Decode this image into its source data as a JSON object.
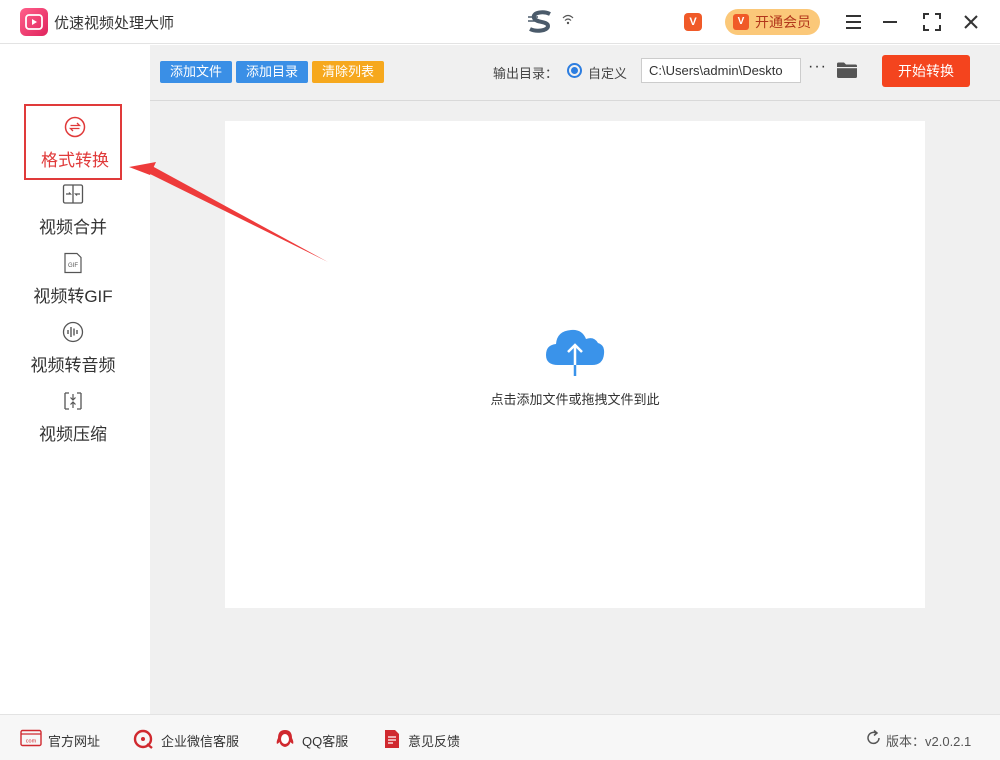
{
  "app": {
    "title": "优速视频处理大师"
  },
  "header": {
    "vip_label": "开通会员",
    "vip_badge": "V"
  },
  "sidebar": {
    "items": [
      {
        "label": "格式转换",
        "active": true
      },
      {
        "label": "视频合并"
      },
      {
        "label": "视频转GIF"
      },
      {
        "label": "视频转音频"
      },
      {
        "label": "视频压缩"
      }
    ]
  },
  "toolbar": {
    "add_file": "添加文件",
    "add_dir": "添加目录",
    "clear_list": "清除列表",
    "output_label": "输出目录：",
    "custom_label": "自定义",
    "output_path": "C:\\Users\\admin\\Deskto",
    "more": "···",
    "start": "开始转换"
  },
  "dropzone": {
    "hint": "点击添加文件或拖拽文件到此"
  },
  "footer": {
    "website": "官方网址",
    "wechat": "企业微信客服",
    "qq": "QQ客服",
    "feedback": "意见反馈",
    "version": "版本：v2.0.2.1"
  },
  "colors": {
    "accent_red": "#e03a3a",
    "button_blue": "#3a8fe6",
    "button_orange": "#f6a81d",
    "start_orange": "#f4441e"
  }
}
